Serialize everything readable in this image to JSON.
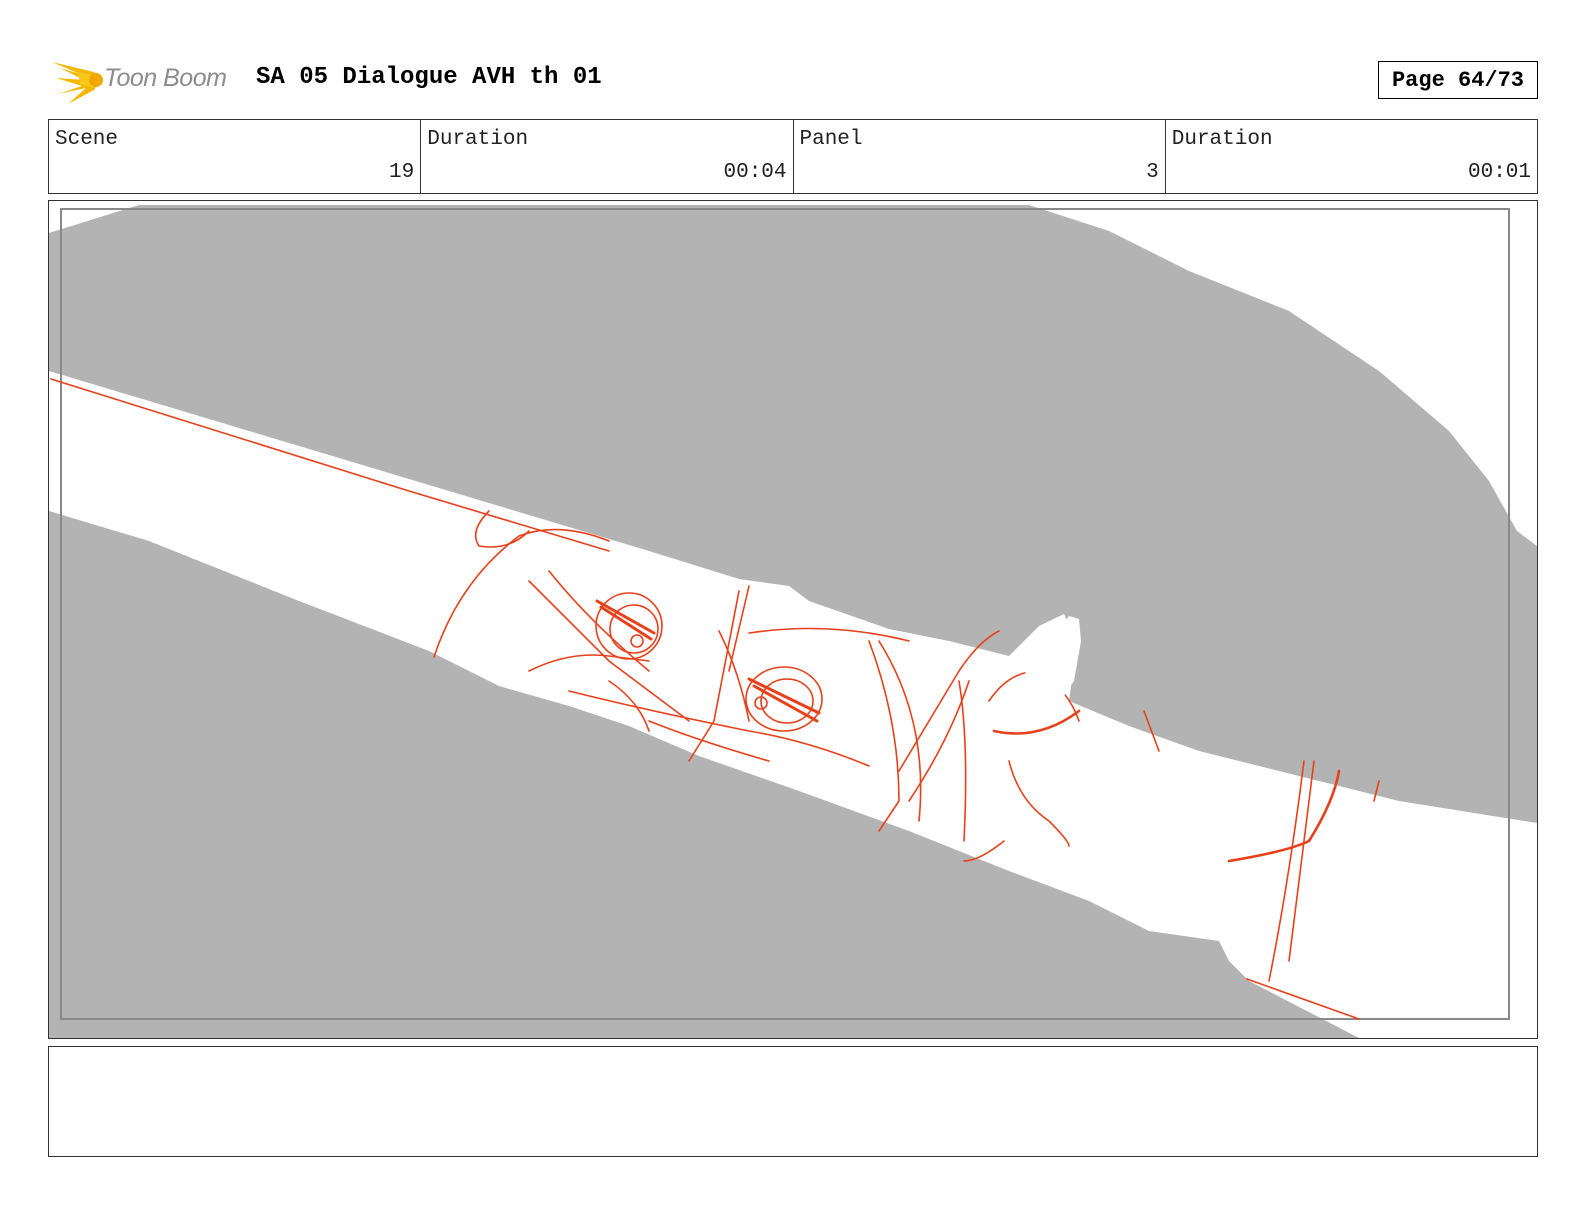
{
  "header": {
    "logo_text": "Toon Boom",
    "title": "SA 05 Dialogue AVH th 01",
    "page": "Page 64/73"
  },
  "info": {
    "scene_label": "Scene",
    "scene_value": "19",
    "scene_duration_label": "Duration",
    "scene_duration_value": "00:04",
    "panel_label": "Panel",
    "panel_value": "3",
    "panel_duration_label": "Duration",
    "panel_duration_value": "00:01"
  },
  "notes": {
    "text": ""
  },
  "colors": {
    "sketch_line": "#e8401a",
    "mask_gray": "#b3b3b3",
    "logo_flame": "#f5b800"
  }
}
